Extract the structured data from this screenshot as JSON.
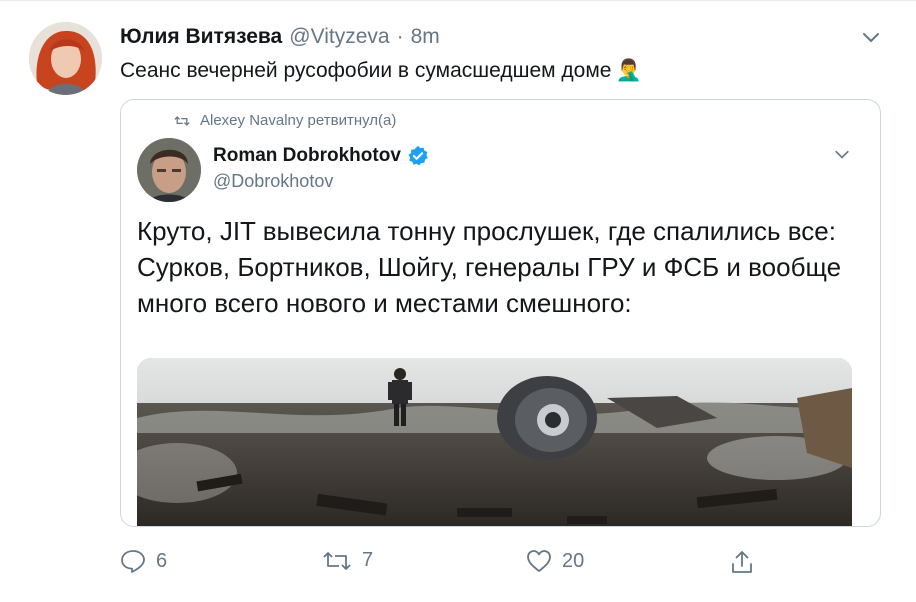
{
  "tweet": {
    "display_name": "Юлия Витязева",
    "handle": "@Vityzeva",
    "separator": "·",
    "time": "8m",
    "text": "Сеанс вечерней русофобии в сумасшедшем доме",
    "emoji": "🤦‍♂️"
  },
  "quote": {
    "retweeted_by": "Alexey Navalny ретвитнул(а)",
    "display_name": "Roman Dobrokhotov",
    "verified": true,
    "handle": "@Dobrokhotov",
    "text": "Круто, JIT вывесила тонну прослушек, где спалились все: Сурков, Бортников, Шойгу, генералы ГРУ и ФСБ и вообще много всего нового и местами смешного:"
  },
  "actions": {
    "reply_count": "6",
    "retweet_count": "7",
    "like_count": "20"
  },
  "colors": {
    "secondary_text": "#657786",
    "verified_blue": "#1da1f2",
    "border": "#ccd6dd"
  },
  "icons": [
    "chevron-down-icon",
    "retweet-icon",
    "verified-badge-icon",
    "reply-icon",
    "like-icon",
    "share-icon"
  ]
}
